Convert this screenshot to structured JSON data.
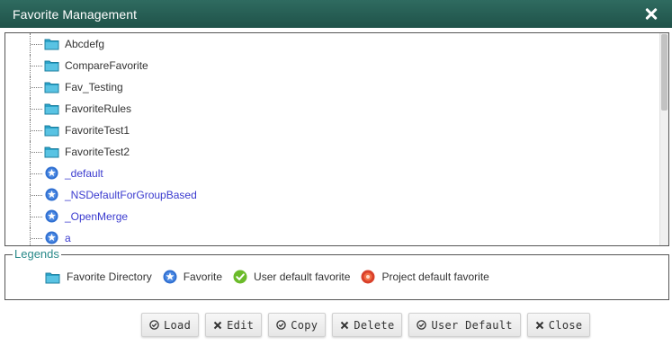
{
  "dialog": {
    "title": "Favorite Management"
  },
  "tree": {
    "items": [
      {
        "label": "Abcdefg",
        "type": "directory",
        "icon": "folder-icon"
      },
      {
        "label": "CompareFavorite",
        "type": "directory",
        "icon": "folder-icon"
      },
      {
        "label": "Fav_Testing",
        "type": "directory",
        "icon": "folder-icon"
      },
      {
        "label": "FavoriteRules",
        "type": "directory",
        "icon": "folder-icon"
      },
      {
        "label": "FavoriteTest1",
        "type": "directory",
        "icon": "folder-icon"
      },
      {
        "label": "FavoriteTest2",
        "type": "directory",
        "icon": "folder-icon"
      },
      {
        "label": "_default",
        "type": "favorite",
        "icon": "favorite-star-icon"
      },
      {
        "label": "_NSDefaultForGroupBased",
        "type": "favorite",
        "icon": "favorite-star-icon"
      },
      {
        "label": "_OpenMerge",
        "type": "favorite",
        "icon": "favorite-star-icon"
      },
      {
        "label": "a",
        "type": "favorite",
        "icon": "favorite-star-icon"
      }
    ]
  },
  "legends": {
    "title": "Legends",
    "items": [
      {
        "label": "Favorite Directory",
        "icon": "folder-icon"
      },
      {
        "label": "Favorite",
        "icon": "favorite-star-icon"
      },
      {
        "label": "User default favorite",
        "icon": "user-default-check-icon"
      },
      {
        "label": "Project default favorite",
        "icon": "project-default-icon"
      }
    ]
  },
  "buttons": {
    "load": "Load",
    "edit": "Edit",
    "copy": "Copy",
    "delete": "Delete",
    "user_default": "User Default",
    "close": "Close"
  },
  "colors": {
    "titlebar": "#1f5249",
    "legend_title": "#2a8a8a",
    "favorite_link": "#3b3bcf",
    "folder": "#2aa3c9",
    "star_badge": "#2f6fd1",
    "user_default": "#6bbb2a",
    "project_default": "#d9402a"
  }
}
